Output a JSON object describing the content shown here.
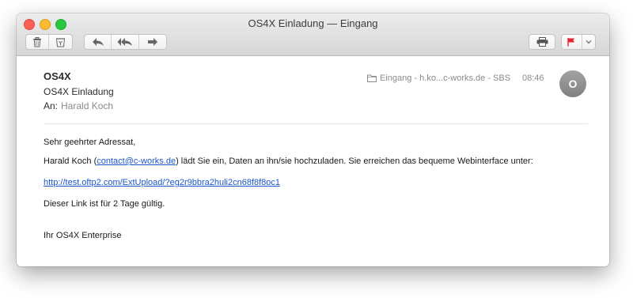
{
  "window": {
    "title": "OS4X Einladung — Eingang"
  },
  "toolbar": {
    "left_buttons": [
      "trash-icon",
      "junk-icon",
      "reply-icon",
      "reply-all-icon",
      "forward-icon"
    ],
    "right_buttons": [
      "print-icon",
      "flag-icon",
      "chevron-down-icon"
    ],
    "flag_color": "#e4262e"
  },
  "message": {
    "sender": "OS4X",
    "subject": "OS4X Einladung",
    "to_label": "An:",
    "to_name": "Harald Koch",
    "mailbox": "Eingang - h.ko...c-works.de - SBS",
    "time": "08:46",
    "avatar_initial": "O"
  },
  "body": {
    "greeting": "Sehr geehrter Adressat,",
    "line1_pre": "Harald Koch (",
    "line1_email": "contact@c-works.de",
    "line1_post": ") lädt Sie ein, Daten an ihn/sie hochzuladen. Sie erreichen das bequeme Webinterface unter:",
    "link": "http://test.oftp2.com/ExtUpload/?eg2r9bbra2huli2cn68f8f8oc1",
    "validity": "Dieser Link ist für 2 Tage gültig.",
    "signature": "Ihr OS4X Enterprise"
  }
}
